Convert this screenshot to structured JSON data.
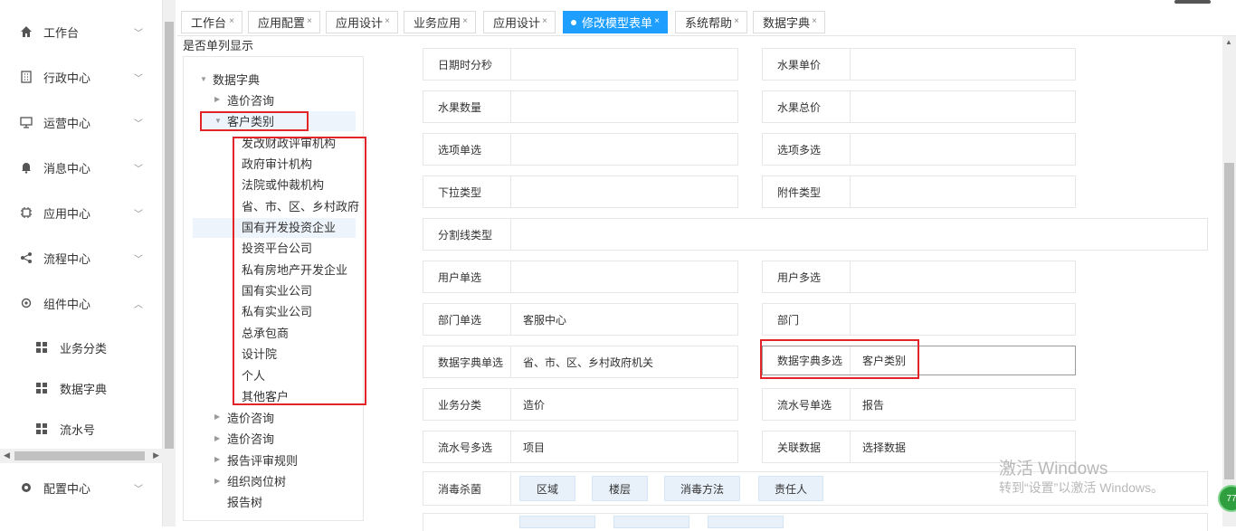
{
  "sidebar": {
    "items": [
      {
        "label": "工作台",
        "icon": "home-icon"
      },
      {
        "label": "行政中心",
        "icon": "building-icon"
      },
      {
        "label": "运营中心",
        "icon": "monitor-icon"
      },
      {
        "label": "消息中心",
        "icon": "bell-icon"
      },
      {
        "label": "应用中心",
        "icon": "chip-icon"
      },
      {
        "label": "流程中心",
        "icon": "share-icon"
      },
      {
        "label": "组件中心",
        "icon": "gear-icon"
      }
    ],
    "sub_items": [
      {
        "label": "业务分类"
      },
      {
        "label": "数据字典"
      },
      {
        "label": "流水号"
      }
    ],
    "bottom_item": {
      "label": "配置中心",
      "icon": "settings-icon"
    }
  },
  "tabs": [
    {
      "label": "工作台"
    },
    {
      "label": "应用配置"
    },
    {
      "label": "应用设计"
    },
    {
      "label": "业务应用"
    },
    {
      "label": "应用设计"
    },
    {
      "label": "修改模型表单",
      "active": true
    },
    {
      "label": "系统帮助"
    },
    {
      "label": "数据字典"
    }
  ],
  "tree": {
    "caption": "是否单列显示",
    "root": "数据字典",
    "nodes": {
      "cost1": "造价咨询",
      "customer": "客户类别",
      "c1": "发改财政评审机构",
      "c2": "政府审计机构",
      "c3": "法院或仲裁机构",
      "c4": "省、市、区、乡村政府",
      "c5": "国有开发投资企业",
      "c6": "投资平台公司",
      "c7": "私有房地产开发企业",
      "c8": "国有实业公司",
      "c9": "私有实业公司",
      "c10": "总承包商",
      "c11": "设计院",
      "c12": "个人",
      "c13": "其他客户",
      "cost2": "造价咨询",
      "cost3": "造价咨询",
      "rules": "报告评审规则",
      "org": "组织岗位树",
      "reportTree": "报告树"
    }
  },
  "form": {
    "datetime": {
      "label": "日期时分秒",
      "value": ""
    },
    "fruit_price": {
      "label": "水果单价",
      "value": ""
    },
    "fruit_qty": {
      "label": "水果数量",
      "value": ""
    },
    "fruit_total": {
      "label": "水果总价",
      "value": ""
    },
    "radio": {
      "label": "选项单选",
      "value": ""
    },
    "checkbox": {
      "label": "选项多选",
      "value": ""
    },
    "dropdown": {
      "label": "下拉类型",
      "value": ""
    },
    "attachment": {
      "label": "附件类型",
      "value": ""
    },
    "divider": {
      "label": "分割线类型",
      "value": ""
    },
    "user_single": {
      "label": "用户单选",
      "value": ""
    },
    "user_multi": {
      "label": "用户多选",
      "value": ""
    },
    "dept_single": {
      "label": "部门单选",
      "value": "客服中心"
    },
    "dept": {
      "label": "部门",
      "value": ""
    },
    "dict_single": {
      "label": "数据字典单选",
      "value": "省、市、区、乡村政府机关"
    },
    "dict_multi": {
      "label": "数据字典多选",
      "value": "客户类别"
    },
    "biz_category": {
      "label": "业务分类",
      "value": "造价"
    },
    "serial_single": {
      "label": "流水号单选",
      "value": "报告"
    },
    "serial_multi": {
      "label": "流水号多选",
      "value": "项目"
    },
    "related": {
      "label": "关联数据",
      "value": "选择数据"
    },
    "disinfect": {
      "label": "消毒杀菌",
      "options": [
        "区域",
        "楼层",
        "消毒方法",
        "责任人"
      ]
    }
  },
  "watermark": {
    "line1": "激活 Windows",
    "line2": "转到“设置”以激活 Windows。"
  },
  "badge": "77"
}
